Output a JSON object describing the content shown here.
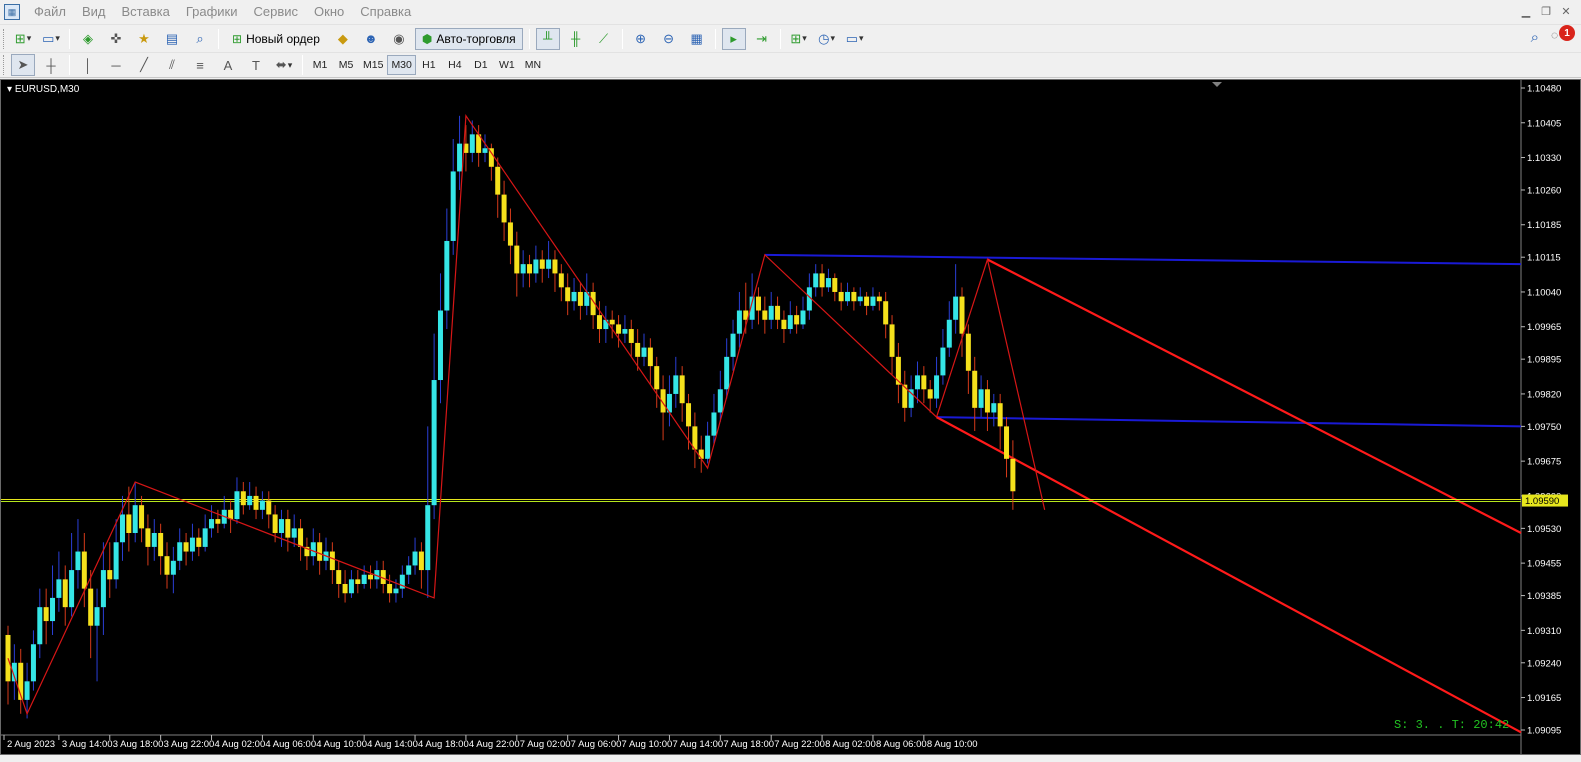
{
  "menu": {
    "items": [
      "Файл",
      "Вид",
      "Вставка",
      "Графики",
      "Сервис",
      "Окно",
      "Справка"
    ]
  },
  "toolbar1": {
    "new_order_label": "Новый ордер",
    "autotrading_label": "Авто-торговля",
    "notification_count": "1"
  },
  "timeframes": [
    "M1",
    "M5",
    "M15",
    "M30",
    "H1",
    "H4",
    "D1",
    "W1",
    "MN"
  ],
  "active_timeframe": "M30",
  "chart": {
    "symbol_label": "EURUSD,M30",
    "current_price": "1.09590",
    "server_info": "S: 3. . T: 20:42",
    "colors": {
      "background": "#000000",
      "bull": "#35e6e6",
      "bear": "#f5e11c",
      "zigzag": "#d61616",
      "channel": "#ff1a1a",
      "level": "#1a1ad6",
      "price_line": "#b5e61d",
      "axis_text": "#ffffff"
    }
  },
  "chart_data": {
    "type": "candlestick",
    "price_axis_ticks": [
      "1.10480",
      "1.10405",
      "1.10330",
      "1.10260",
      "1.10185",
      "1.10115",
      "1.10040",
      "1.09965",
      "1.09895",
      "1.09820",
      "1.09750",
      "1.09675",
      "1.09600",
      "1.09530",
      "1.09455",
      "1.09385",
      "1.09310",
      "1.09240",
      "1.09165",
      "1.09095"
    ],
    "time_axis_ticks": [
      "2 Aug 2023",
      "3 Aug 14:00",
      "3 Aug 18:00",
      "3 Aug 22:00",
      "4 Aug 02:00",
      "4 Aug 06:00",
      "4 Aug 10:00",
      "4 Aug 14:00",
      "4 Aug 18:00",
      "4 Aug 22:00",
      "7 Aug 02:00",
      "7 Aug 06:00",
      "7 Aug 10:00",
      "7 Aug 14:00",
      "7 Aug 18:00",
      "7 Aug 22:00",
      "8 Aug 02:00",
      "8 Aug 06:00",
      "8 Aug 10:00"
    ],
    "ylim": [
      1.09095,
      1.1048
    ],
    "current_price": 1.0959,
    "zigzag": [
      {
        "bar": 0,
        "price": 1.0925
      },
      {
        "bar": 3,
        "price": 1.0913
      },
      {
        "bar": 20,
        "price": 1.0963
      },
      {
        "bar": 67,
        "price": 1.0938
      },
      {
        "bar": 72,
        "price": 1.1042
      },
      {
        "bar": 110,
        "price": 1.0966
      },
      {
        "bar": 119,
        "price": 1.1012
      },
      {
        "bar": 146,
        "price": 1.0977
      },
      {
        "bar": 154,
        "price": 1.1011
      },
      {
        "bar": 163,
        "price": 1.0957
      }
    ],
    "levels": [
      {
        "name": "upper",
        "from_bar": 119,
        "from_price": 1.1012,
        "to_price": 1.101
      },
      {
        "name": "lower",
        "from_bar": 146,
        "from_price": 1.0977,
        "to_price": 1.0975
      }
    ],
    "channel": [
      {
        "from_bar": 154,
        "from_price": 1.1011,
        "to_price": 1.0952
      },
      {
        "from_bar": 146,
        "from_price": 1.0977,
        "to_price": 1.0909
      }
    ],
    "candles": [
      [
        1.093,
        1.092,
        1.0932,
        1.0915
      ],
      [
        1.092,
        1.0924,
        1.0928,
        1.0916
      ],
      [
        1.0924,
        1.0916,
        1.0927,
        1.0913
      ],
      [
        1.0916,
        1.092,
        1.0924,
        1.0912
      ],
      [
        1.092,
        1.0928,
        1.0931,
        1.0918
      ],
      [
        1.0928,
        1.0936,
        1.094,
        1.0925
      ],
      [
        1.0936,
        1.0933,
        1.094,
        1.0928
      ],
      [
        1.0933,
        1.0938,
        1.0945,
        1.093
      ],
      [
        1.0938,
        1.0942,
        1.0948,
        1.0935
      ],
      [
        1.0942,
        1.0936,
        1.0945,
        1.0932
      ],
      [
        1.0936,
        1.0944,
        1.0952,
        1.0934
      ],
      [
        1.0944,
        1.0948,
        1.0955,
        1.094
      ],
      [
        1.0948,
        1.094,
        1.0952,
        1.0936
      ],
      [
        1.094,
        1.0932,
        1.0944,
        1.0925
      ],
      [
        1.0932,
        1.0936,
        1.094,
        1.092
      ],
      [
        1.0936,
        1.0944,
        1.095,
        1.093
      ],
      [
        1.0944,
        1.0942,
        1.095,
        1.0938
      ],
      [
        1.0942,
        1.095,
        1.0955,
        1.094
      ],
      [
        1.095,
        1.0956,
        1.096,
        1.0946
      ],
      [
        1.0956,
        1.0952,
        1.0962,
        1.0948
      ],
      [
        1.0952,
        1.0958,
        1.0963,
        1.095
      ],
      [
        1.0958,
        1.0953,
        1.096,
        1.095
      ],
      [
        1.0953,
        1.0949,
        1.0956,
        1.0945
      ],
      [
        1.0949,
        1.0952,
        1.0955,
        1.0946
      ],
      [
        1.0952,
        1.0947,
        1.0954,
        1.0943
      ],
      [
        1.0947,
        1.0943,
        1.095,
        1.094
      ],
      [
        1.0943,
        1.0946,
        1.0949,
        1.0939
      ],
      [
        1.0946,
        1.095,
        1.0953,
        1.0944
      ],
      [
        1.095,
        1.0948,
        1.0952,
        1.0945
      ],
      [
        1.0948,
        1.0951,
        1.0954,
        1.0946
      ],
      [
        1.0951,
        1.0949,
        1.0953,
        1.0947
      ],
      [
        1.0949,
        1.0953,
        1.0956,
        1.0948
      ],
      [
        1.0953,
        1.0955,
        1.0958,
        1.0951
      ],
      [
        1.0955,
        1.0954,
        1.0957,
        1.0952
      ],
      [
        1.0954,
        1.0957,
        1.096,
        1.0953
      ],
      [
        1.0957,
        1.0955,
        1.0959,
        1.0952
      ],
      [
        1.0955,
        1.0961,
        1.0964,
        1.0954
      ],
      [
        1.0961,
        1.0958,
        1.0963,
        1.0956
      ],
      [
        1.0958,
        1.096,
        1.0963,
        1.0957
      ],
      [
        1.096,
        1.0957,
        1.0962,
        1.0955
      ],
      [
        1.0957,
        1.0959,
        1.0961,
        1.0955
      ],
      [
        1.0959,
        1.0956,
        1.0961,
        1.0953
      ],
      [
        1.0956,
        1.0952,
        1.0958,
        1.095
      ],
      [
        1.0952,
        1.0955,
        1.0957,
        1.0949
      ],
      [
        1.0955,
        1.0951,
        1.0957,
        1.0948
      ],
      [
        1.0951,
        1.0953,
        1.0956,
        1.0949
      ],
      [
        1.0953,
        1.0949,
        1.0955,
        1.0946
      ],
      [
        1.0949,
        1.0947,
        1.0951,
        1.0944
      ],
      [
        1.0947,
        1.095,
        1.0953,
        1.0945
      ],
      [
        1.095,
        1.0946,
        1.0952,
        1.0943
      ],
      [
        1.0946,
        1.0948,
        1.0951,
        1.0944
      ],
      [
        1.0948,
        1.0944,
        1.095,
        1.0941
      ],
      [
        1.0944,
        1.0941,
        1.0946,
        1.0938
      ],
      [
        1.0941,
        1.0939,
        1.0944,
        1.0937
      ],
      [
        1.0939,
        1.0942,
        1.0944,
        1.0938
      ],
      [
        1.0942,
        1.0941,
        1.0944,
        1.0939
      ],
      [
        1.0941,
        1.0943,
        1.0945,
        1.094
      ],
      [
        1.0943,
        1.0942,
        1.0945,
        1.094
      ],
      [
        1.0942,
        1.0944,
        1.0946,
        1.094
      ],
      [
        1.0944,
        1.0941,
        1.0946,
        1.0939
      ],
      [
        1.0941,
        1.0939,
        1.0943,
        1.0937
      ],
      [
        1.0939,
        1.094,
        1.0942,
        1.0937
      ],
      [
        1.094,
        1.0943,
        1.0945,
        1.0938
      ],
      [
        1.0943,
        1.0945,
        1.0947,
        1.0941
      ],
      [
        1.0945,
        1.0948,
        1.0951,
        1.0943
      ],
      [
        1.0948,
        1.0944,
        1.095,
        1.094
      ],
      [
        1.0944,
        1.0958,
        1.0975,
        1.0938
      ],
      [
        1.0958,
        1.0985,
        1.0995,
        1.0955
      ],
      [
        1.0985,
        1.1,
        1.1008,
        1.098
      ],
      [
        1.1,
        1.1015,
        1.1022,
        1.0996
      ],
      [
        1.1015,
        1.103,
        1.1037,
        1.1012
      ],
      [
        1.103,
        1.1036,
        1.1042,
        1.1026
      ],
      [
        1.1036,
        1.1034,
        1.104,
        1.103
      ],
      [
        1.1034,
        1.1038,
        1.1041,
        1.1032
      ],
      [
        1.1038,
        1.1034,
        1.104,
        1.1031
      ],
      [
        1.1034,
        1.1035,
        1.1038,
        1.1032
      ],
      [
        1.1035,
        1.1031,
        1.1036,
        1.1028
      ],
      [
        1.1031,
        1.1025,
        1.1033,
        1.102
      ],
      [
        1.1025,
        1.1019,
        1.1028,
        1.1015
      ],
      [
        1.1019,
        1.1014,
        1.1022,
        1.101
      ],
      [
        1.1014,
        1.1008,
        1.1017,
        1.1003
      ],
      [
        1.1008,
        1.101,
        1.1013,
        1.1005
      ],
      [
        1.101,
        1.1008,
        1.1012,
        1.1005
      ],
      [
        1.1008,
        1.1011,
        1.1014,
        1.1006
      ],
      [
        1.1011,
        1.1009,
        1.1013,
        1.1006
      ],
      [
        1.1009,
        1.1011,
        1.1015,
        1.1007
      ],
      [
        1.1011,
        1.1008,
        1.1013,
        1.1004
      ],
      [
        1.1008,
        1.1005,
        1.101,
        1.1002
      ],
      [
        1.1005,
        1.1002,
        1.1008,
        1.0999
      ],
      [
        1.1002,
        1.1004,
        1.1007,
        1.1
      ],
      [
        1.1004,
        1.1001,
        1.1006,
        1.0998
      ],
      [
        1.1001,
        1.1004,
        1.1008,
        1.0999
      ],
      [
        1.1004,
        1.0999,
        1.1006,
        1.0996
      ],
      [
        1.0999,
        1.0996,
        1.1002,
        1.0993
      ],
      [
        1.0996,
        1.0998,
        1.1001,
        1.0993
      ],
      [
        1.0998,
        1.0997,
        1.1,
        1.0994
      ],
      [
        1.0997,
        1.0995,
        1.0999,
        1.0992
      ],
      [
        1.0995,
        1.0996,
        1.0999,
        1.0993
      ],
      [
        1.0996,
        1.0993,
        1.0998,
        1.099
      ],
      [
        1.0993,
        1.099,
        1.0996,
        1.0987
      ],
      [
        1.099,
        1.0992,
        1.0995,
        1.0988
      ],
      [
        1.0992,
        1.0988,
        1.0994,
        1.0984
      ],
      [
        1.0988,
        1.0983,
        1.099,
        1.0979
      ],
      [
        1.0983,
        1.0978,
        1.0986,
        1.0972
      ],
      [
        1.0978,
        1.0982,
        1.0986,
        1.0975
      ],
      [
        1.0982,
        1.0986,
        1.099,
        1.0979
      ],
      [
        1.0986,
        1.098,
        1.0988,
        1.0976
      ],
      [
        1.098,
        1.0975,
        1.0982,
        1.097
      ],
      [
        1.0975,
        1.097,
        1.0978,
        1.0966
      ],
      [
        1.097,
        1.0968,
        1.0973,
        1.0965
      ],
      [
        1.0968,
        1.0973,
        1.0976,
        1.0967
      ],
      [
        1.0973,
        1.0978,
        1.0982,
        1.0971
      ],
      [
        1.0978,
        1.0983,
        1.0987,
        1.0976
      ],
      [
        1.0983,
        1.099,
        1.0994,
        1.0981
      ],
      [
        1.099,
        1.0995,
        1.0998,
        1.0987
      ],
      [
        1.0995,
        1.1,
        1.1004,
        1.0992
      ],
      [
        1.1,
        1.0998,
        1.1006,
        1.0995
      ],
      [
        1.0998,
        1.1003,
        1.1008,
        1.0996
      ],
      [
        1.1003,
        1.1,
        1.1005,
        1.0997
      ],
      [
        1.1,
        1.0998,
        1.1003,
        1.0995
      ],
      [
        1.0998,
        1.1001,
        1.1004,
        1.0996
      ],
      [
        1.1001,
        1.0998,
        1.1003,
        1.0996
      ],
      [
        1.0998,
        1.0996,
        1.1,
        1.0993
      ],
      [
        1.0996,
        1.0999,
        1.1002,
        1.0995
      ],
      [
        1.0999,
        1.0997,
        1.1001,
        1.0995
      ],
      [
        1.0997,
        1.1,
        1.1003,
        1.0996
      ],
      [
        1.1,
        1.1005,
        1.1008,
        1.0998
      ],
      [
        1.1005,
        1.1008,
        1.101,
        1.1003
      ],
      [
        1.1008,
        1.1005,
        1.101,
        1.1003
      ],
      [
        1.1005,
        1.1007,
        1.1009,
        1.1004
      ],
      [
        1.1007,
        1.1004,
        1.1008,
        1.1002
      ],
      [
        1.1004,
        1.1002,
        1.1006,
        1.1
      ],
      [
        1.1002,
        1.1004,
        1.1006,
        1.1001
      ],
      [
        1.1004,
        1.1002,
        1.1005,
        1.1
      ],
      [
        1.1002,
        1.1003,
        1.1005,
        1.1001
      ],
      [
        1.1003,
        1.1001,
        1.1004,
        1.0999
      ],
      [
        1.1001,
        1.1003,
        1.1005,
        1.1
      ],
      [
        1.1003,
        1.1002,
        1.1004,
        1.1
      ],
      [
        1.1002,
        1.0997,
        1.1004,
        1.0994
      ],
      [
        1.0997,
        1.099,
        1.0999,
        1.0986
      ],
      [
        1.099,
        1.0984,
        1.0993,
        1.098
      ],
      [
        1.0984,
        1.0979,
        1.0987,
        1.0976
      ],
      [
        1.0979,
        1.0983,
        1.0986,
        1.0977
      ],
      [
        1.0983,
        1.0986,
        1.0989,
        1.098
      ],
      [
        1.0986,
        1.0983,
        1.0988,
        1.098
      ],
      [
        1.0983,
        1.0981,
        1.0985,
        1.0978
      ],
      [
        1.0981,
        1.0986,
        1.099,
        1.0979
      ],
      [
        1.0986,
        1.0992,
        1.0996,
        1.0984
      ],
      [
        1.0992,
        1.0998,
        1.1002,
        1.099
      ],
      [
        1.0998,
        1.1003,
        1.101,
        1.0995
      ],
      [
        1.1003,
        1.0995,
        1.1005,
        1.099
      ],
      [
        1.0995,
        1.0987,
        1.0997,
        1.0982
      ],
      [
        1.0987,
        1.0979,
        1.099,
        1.0974
      ],
      [
        1.0979,
        1.0983,
        1.0986,
        1.0977
      ],
      [
        1.0983,
        1.0978,
        1.0985,
        1.0974
      ],
      [
        1.0978,
        1.098,
        1.0982,
        1.0975
      ],
      [
        1.098,
        1.0975,
        1.0982,
        1.097
      ],
      [
        1.0975,
        1.0968,
        1.0977,
        1.0964
      ],
      [
        1.0968,
        1.0961,
        1.0972,
        1.0957
      ]
    ]
  }
}
